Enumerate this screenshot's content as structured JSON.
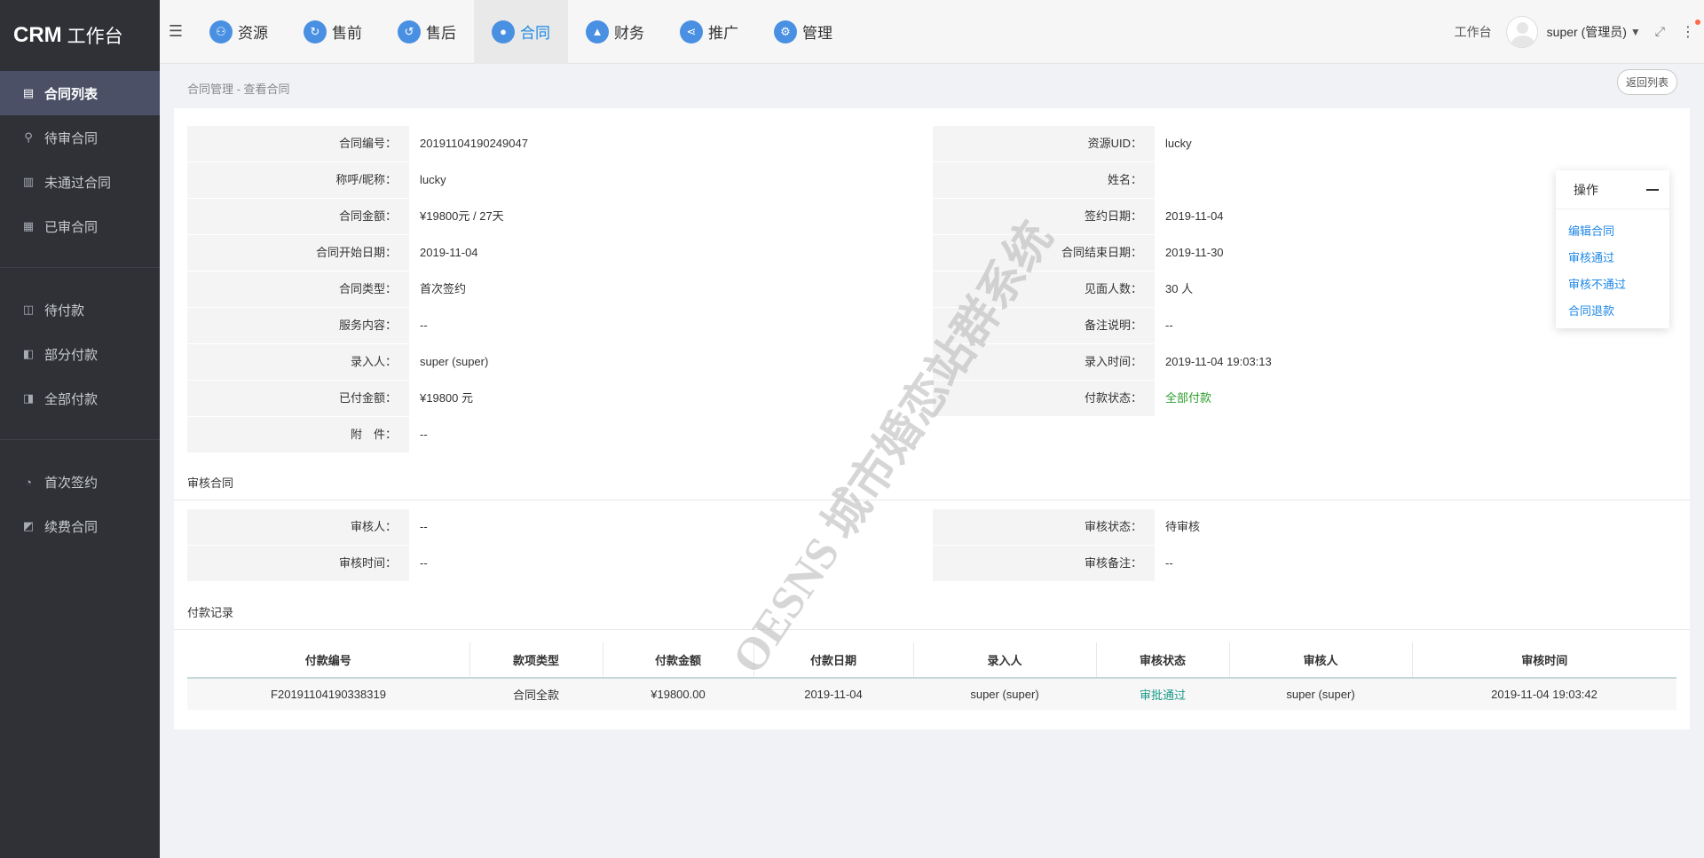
{
  "brand": {
    "bold": "CRM",
    "rest": "工作台"
  },
  "sidebar": {
    "groups": [
      [
        {
          "label": "合同列表",
          "icon": "document-list-icon",
          "active": true
        },
        {
          "label": "待审合同",
          "icon": "user-stamp-icon"
        },
        {
          "label": "未通过合同",
          "icon": "rejected-doc-icon"
        },
        {
          "label": "已审合同",
          "icon": "approved-doc-icon"
        }
      ],
      [
        {
          "label": "待付款",
          "icon": "wallet-icon"
        },
        {
          "label": "部分付款",
          "icon": "partial-pay-icon"
        },
        {
          "label": "全部付款",
          "icon": "full-pay-icon"
        }
      ],
      [
        {
          "label": "首次签约",
          "icon": "first-sign-icon"
        },
        {
          "label": "续费合同",
          "icon": "renew-icon"
        }
      ]
    ]
  },
  "topnav": {
    "items": [
      {
        "label": "资源",
        "icon": "resource-icon"
      },
      {
        "label": "售前",
        "icon": "presale-icon"
      },
      {
        "label": "售后",
        "icon": "aftersale-icon"
      },
      {
        "label": "合同",
        "icon": "contract-user-icon",
        "active": true
      },
      {
        "label": "财务",
        "icon": "finance-chart-icon"
      },
      {
        "label": "推广",
        "icon": "share-icon"
      },
      {
        "label": "管理",
        "icon": "gear-icon"
      }
    ],
    "workbench": "工作台",
    "user": "super (管理员)"
  },
  "breadcrumb": "合同管理 - 查看合同",
  "back_button": "返回列表",
  "contract": {
    "left": [
      {
        "label": "合同编号：",
        "value": "20191104190249047"
      },
      {
        "label": "称呼/昵称：",
        "value": "lucky"
      },
      {
        "label": "合同金额：",
        "value": "¥19800元 / 27天"
      },
      {
        "label": "合同开始日期：",
        "value": "2019-11-04"
      },
      {
        "label": "合同类型：",
        "value": "首次签约"
      },
      {
        "label": "服务内容：",
        "value": "--"
      },
      {
        "label": "录入人：",
        "value": "super (super)"
      },
      {
        "label": "已付金额：",
        "value": "¥19800 元"
      },
      {
        "label": "附　件：",
        "value": "--"
      }
    ],
    "right": [
      {
        "label": "资源UID：",
        "value": "lucky"
      },
      {
        "label": "姓名：",
        "value": ""
      },
      {
        "label": "签约日期：",
        "value": "2019-11-04"
      },
      {
        "label": "合同结束日期：",
        "value": "2019-11-30"
      },
      {
        "label": "见面人数：",
        "value": "30 人"
      },
      {
        "label": "备注说明：",
        "value": "--"
      },
      {
        "label": "录入时间：",
        "value": "2019-11-04 19:03:13"
      },
      {
        "label": "付款状态：",
        "value": "全部付款",
        "status": "green"
      }
    ]
  },
  "review": {
    "title": "审核合同",
    "left": [
      {
        "label": "审核人：",
        "value": "--"
      },
      {
        "label": "审核时间：",
        "value": "--"
      }
    ],
    "right": [
      {
        "label": "审核状态：",
        "value": "待审核"
      },
      {
        "label": "审核备注：",
        "value": "--"
      }
    ]
  },
  "payments": {
    "title": "付款记录",
    "columns": [
      "付款编号",
      "款项类型",
      "付款金额",
      "付款日期",
      "录入人",
      "审核状态",
      "审核人",
      "审核时间"
    ],
    "rows": [
      [
        "F20191104190338319",
        "合同全款",
        "¥19800.00",
        "2019-11-04",
        "super (super)",
        "审批通过",
        "super (super)",
        "2019-11-04 19:03:42"
      ]
    ]
  },
  "operations": {
    "title": "操作",
    "links": [
      "编辑合同",
      "审核通过",
      "审核不通过",
      "合同退款"
    ]
  },
  "watermark": "OESNS 城市婚恋站群系统"
}
